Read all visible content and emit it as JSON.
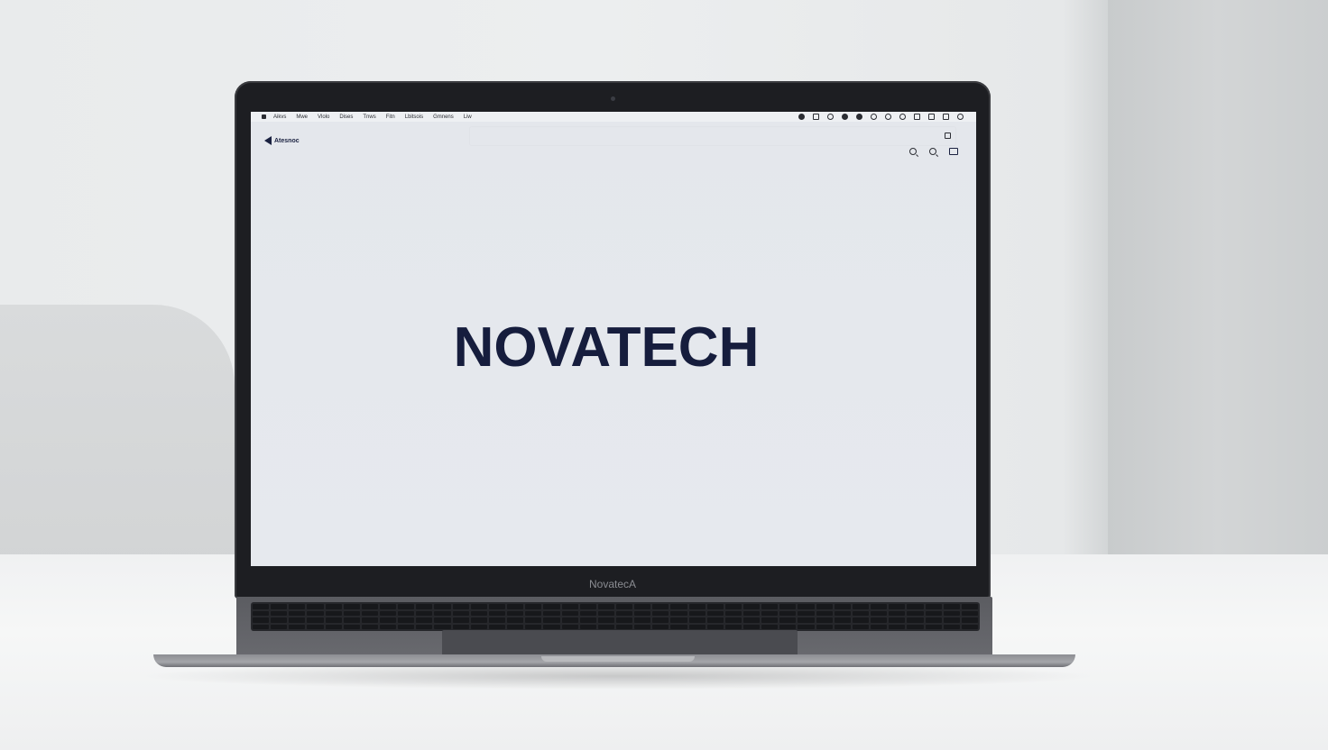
{
  "scene": {
    "laptop_brand": "NovatecA"
  },
  "browser": {
    "menu_items": [
      "",
      "Aikvs",
      "Mwe",
      "Vlolo",
      "Dises",
      "Tnws",
      "Fitn",
      "Lbitsois",
      "Gmnens",
      "Liw"
    ],
    "site_brand": "Atesnoc",
    "hero_title": "NOVATECH"
  },
  "icons": {
    "search": "search-icon",
    "zoom": "magnifier-icon",
    "cart": "cart-icon",
    "lock": "lock-icon"
  },
  "colors": {
    "brand_navy": "#161d3d",
    "screen_bg": "#e5e8ed",
    "laptop_body": "#5b5c61"
  }
}
